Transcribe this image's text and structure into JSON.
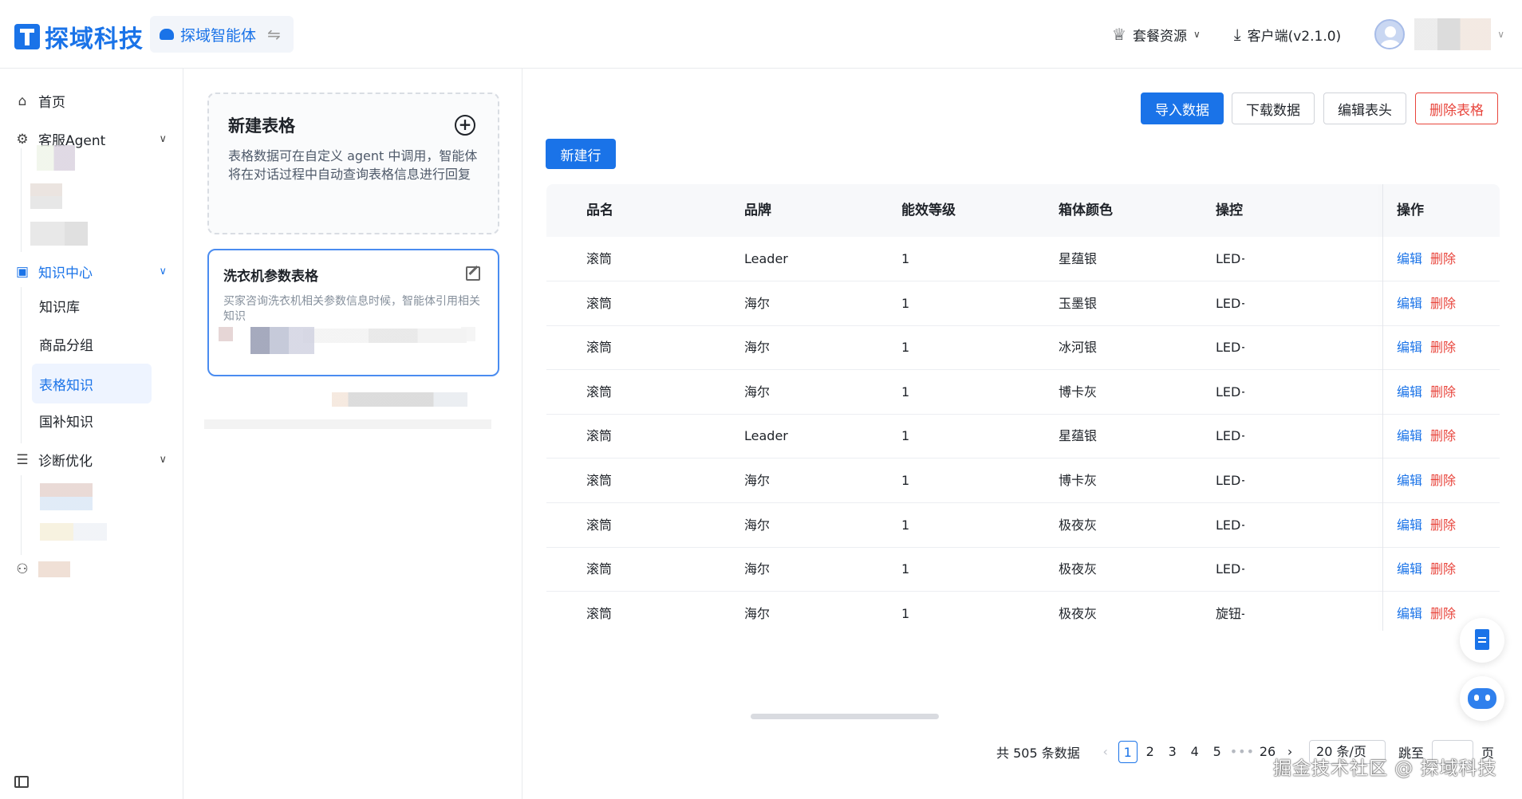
{
  "brand": {
    "logo_text": "探域科技",
    "agent_name": "探域智能体"
  },
  "header": {
    "plan_label": "套餐资源",
    "client_label": "客户端(v2.1.0)"
  },
  "sidebar": {
    "home": "首页",
    "agent": "客服Agent",
    "knowledge": "知识中心",
    "knowledge_items": [
      "知识库",
      "商品分组",
      "表格知识",
      "国补知识"
    ],
    "diagnose": "诊断优化"
  },
  "tables_panel": {
    "new_title": "新建表格",
    "new_desc": "表格数据可在自定义 agent 中调用，智能体将在对话过程中自动查询表格信息进行回复",
    "card_title": "洗衣机参数表格",
    "card_desc": "买家咨询洗衣机相关参数信息时候，智能体引用相关知识"
  },
  "toolbar": {
    "import": "导入数据",
    "download": "下载数据",
    "edit_header": "编辑表头",
    "delete_table": "删除表格",
    "new_row": "新建行"
  },
  "table": {
    "columns": [
      "品名",
      "品牌",
      "能效等级",
      "箱体颜色",
      "操控",
      "操作"
    ],
    "edit_label": "编辑",
    "delete_label": "删除",
    "rows": [
      [
        "滚筒",
        "Leader",
        "1",
        "星蕴银",
        "LED+"
      ],
      [
        "滚筒",
        "海尔",
        "1",
        "玉墨银",
        "LED+"
      ],
      [
        "滚筒",
        "海尔",
        "1",
        "冰河银",
        "LED+"
      ],
      [
        "滚筒",
        "海尔",
        "1",
        "博卡灰",
        "LED+"
      ],
      [
        "滚筒",
        "Leader",
        "1",
        "星蕴银",
        "LED+"
      ],
      [
        "滚筒",
        "海尔",
        "1",
        "博卡灰",
        "LED+"
      ],
      [
        "滚筒",
        "海尔",
        "1",
        "极夜灰",
        "LED+"
      ],
      [
        "滚筒",
        "海尔",
        "1",
        "极夜灰",
        "LED+"
      ],
      [
        "滚筒",
        "海尔",
        "1",
        "极夜灰",
        "旋钮-"
      ]
    ]
  },
  "pagination": {
    "total": "共 505 条数据",
    "pages": [
      "1",
      "2",
      "3",
      "4",
      "5"
    ],
    "ellipsis": "•••",
    "last": "26",
    "page_size": "20 条/页",
    "jump_label": "跳至",
    "page_suffix": "页"
  },
  "watermark": "掘金技术社区 @ 探域科技"
}
